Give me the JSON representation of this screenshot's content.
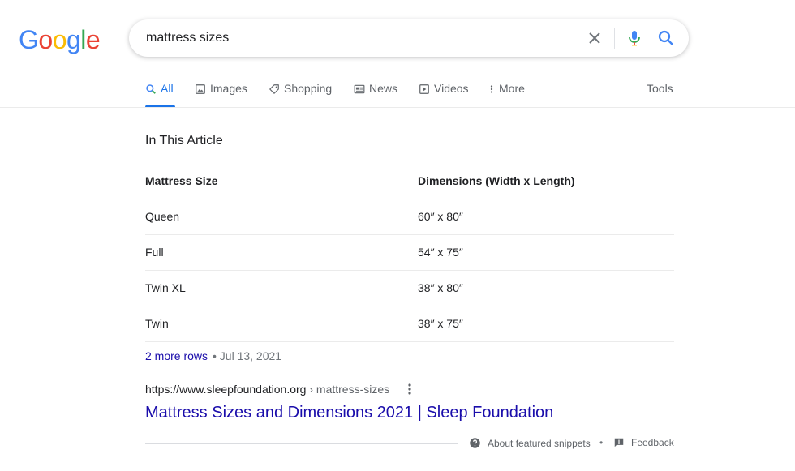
{
  "logo": {
    "letters": [
      "G",
      "o",
      "o",
      "g",
      "l",
      "e"
    ],
    "colors": [
      "#4285F4",
      "#EA4335",
      "#FBBC05",
      "#4285F4",
      "#34A853",
      "#EA4335"
    ]
  },
  "search": {
    "value": "mattress sizes",
    "icons": [
      "close-icon",
      "mic-icon",
      "search-icon"
    ]
  },
  "tabs": [
    {
      "label": "All",
      "icon": "search-icon",
      "active": true
    },
    {
      "label": "Images",
      "icon": "image-icon"
    },
    {
      "label": "Shopping",
      "icon": "tag-icon"
    },
    {
      "label": "News",
      "icon": "news-icon"
    },
    {
      "label": "Videos",
      "icon": "video-icon"
    },
    {
      "label": "More",
      "icon": "more-vert-icon"
    }
  ],
  "tools_label": "Tools",
  "snippet": {
    "heading": "In This Article",
    "columns": [
      "Mattress Size",
      "Dimensions (Width x Length)"
    ],
    "rows": [
      [
        "Queen",
        "60″ x 80″"
      ],
      [
        "Full",
        "54″ x 75″"
      ],
      [
        "Twin XL",
        "38″ x 80″"
      ],
      [
        "Twin",
        "38″ x 75″"
      ]
    ],
    "more_rows": "2 more rows",
    "separator": "•",
    "date": "Jul 13, 2021"
  },
  "result": {
    "url_domain": "https://www.sleepfoundation.org",
    "url_path": " › mattress-sizes",
    "title": "Mattress Sizes and Dimensions 2021 | Sleep Foundation"
  },
  "footer": {
    "about": "About featured snippets",
    "dot": "•",
    "feedback": "Feedback"
  },
  "colors": {
    "link": "#1a0dab",
    "accent": "#1a73e8",
    "muted": "#5f6368"
  }
}
